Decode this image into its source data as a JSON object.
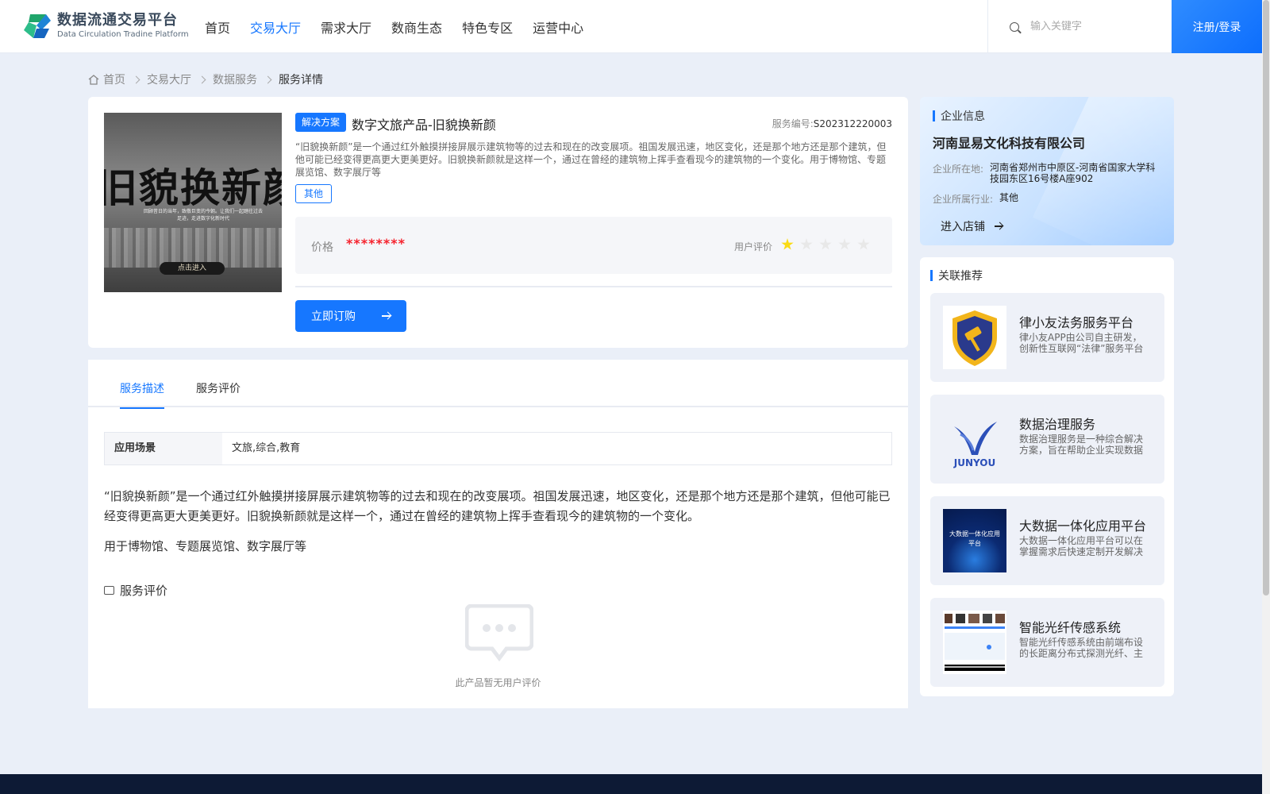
{
  "header": {
    "logo_cn": "数据流通交易平台",
    "logo_en": "Data Circulation Tradine Platform",
    "nav": [
      "首页",
      "交易大厅",
      "需求大厅",
      "数商生态",
      "特色专区",
      "运营中心"
    ],
    "active_nav_index": 1,
    "search_placeholder": "输入关键字",
    "login_label": "注册/登录"
  },
  "breadcrumb": [
    "首页",
    "交易大厅",
    "数据服务",
    "服务详情"
  ],
  "product": {
    "image_title": "旧貌换新颜",
    "image_sub": "回顾昔日的当年，致敬巨变的今朝。让我们一起踏往过去足迹，走进数字化新时代",
    "image_button": "点击进入",
    "tag": "解决方案",
    "title": "数字文旅产品-旧貌换新颜",
    "service_no_label": "服务编号:",
    "service_no": "S202312220003",
    "description": "“旧貌换新颜”是一个通过红外触摸拼接屏展示建筑物等的过去和现在的改变展项。祖国发展迅速，地区变化，还是那个地方还是那个建筑，但他可能已经变得更高更大更美更好。旧貌换新颜就是这样一个，通过在曾经的建筑物上挥手查看现今的建筑物的一个变化。用于博物馆、专题展览馆、数字展厅等",
    "category_tag": "其他",
    "price_label": "价格",
    "price_value": "********",
    "rating_label": "用户评价",
    "rating": 1,
    "rating_max": 5,
    "order_label": "立即订购"
  },
  "detail": {
    "tabs": [
      "服务描述",
      "服务评价"
    ],
    "active_tab": 0,
    "spec_key": "应用场景",
    "spec_value": "文旅,综合,教育",
    "paragraph1": "“旧貌换新颜”是一个通过红外触摸拼接屏展示建筑物等的过去和现在的改变展项。祖国发展迅速，地区变化，还是那个地方还是那个建筑，但他可能已经变得更高更大更美更好。旧貌换新颜就是这样一个，通过在曾经的建筑物上挥手查看现今的建筑物的一个变化。",
    "paragraph2": "用于博物馆、专题展览馆、数字展厅等",
    "eval_title": "服务评价",
    "empty_text": "此产品暂无用户评价"
  },
  "company": {
    "section_title": "企业信息",
    "name": "河南显易文化科技有限公司",
    "location_label": "企业所在地:",
    "location": "河南省郑州市中原区-河南省国家大学科技园东区16号楼A座902",
    "industry_label": "企业所属行业:",
    "industry": "其他",
    "shop_link": "进入店铺"
  },
  "recommend": {
    "section_title": "关联推荐",
    "items": [
      {
        "title": "律小友法务服务平台",
        "desc": "律小友APP由公司自主研发，创新性互联网“法律”服务平台"
      },
      {
        "title": "数据治理服务",
        "desc": "数据治理服务是一种综合解决方案，旨在帮助企业实现数据价值"
      },
      {
        "title": "大数据一体化应用平台",
        "desc": "大数据一体化应用平台可以在掌握需求后快速定制开发解决方案"
      },
      {
        "title": "智能光纤传感系统",
        "desc": "智能光纤传感系统由前端布设的长距离分布式探测光纤、主机组成"
      }
    ],
    "thumb_texts": [
      "JUNYOU",
      "大数据一体化应用平台"
    ]
  }
}
